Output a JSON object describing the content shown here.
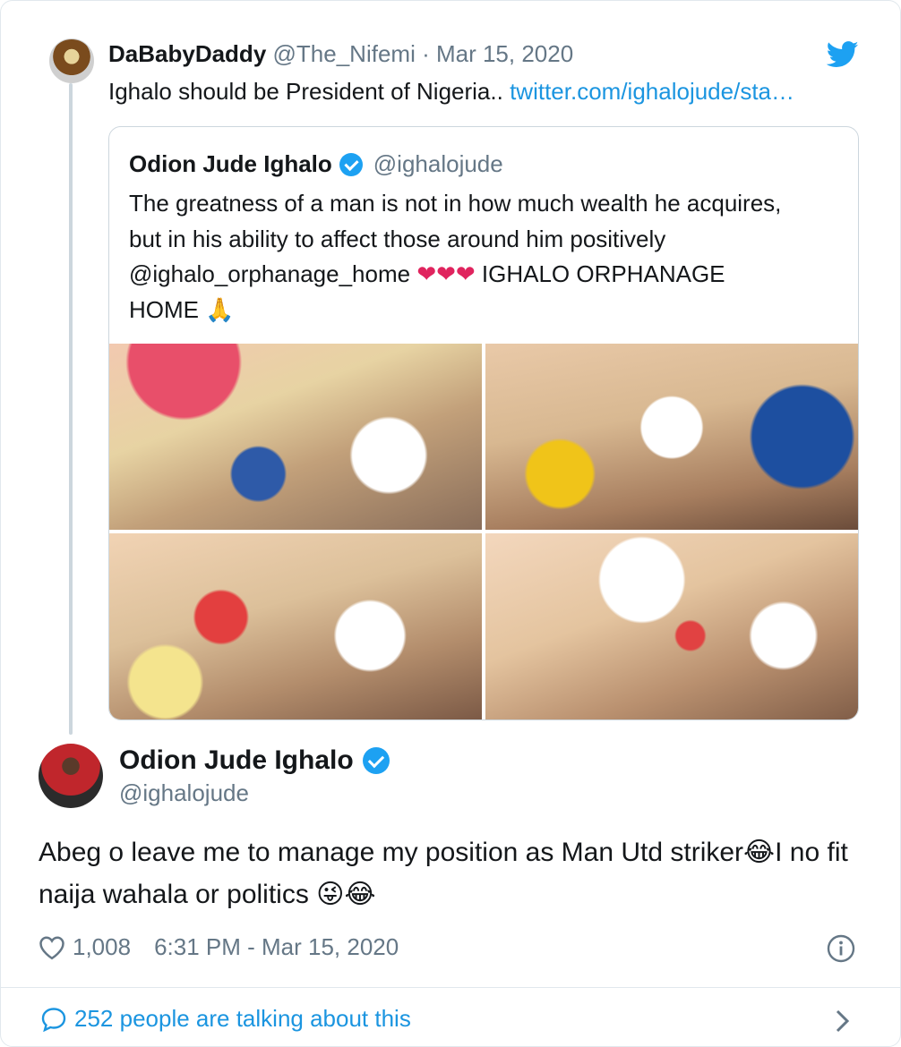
{
  "parent_tweet": {
    "name": "DaBabyDaddy",
    "handle": "@The_Nifemi",
    "separator": " · ",
    "date": "Mar 15, 2020",
    "text": "Ighalo should be President of Nigeria..",
    "link": "twitter.com/ighalojude/sta…"
  },
  "quoted_tweet": {
    "name": "Odion Jude Ighalo",
    "handle": "@ighalojude",
    "text_line1": "The greatness of a man is not in how much wealth he acquires,",
    "text_line2": "but in his ability to affect those around him positively",
    "text_mention": "@ighalo_orphanage_home ",
    "hearts": "❤❤❤",
    "text_after_hearts": " IGHALO ORPHANAGE",
    "text_line4": "HOME ",
    "pray": "🙏",
    "photos": [
      "photo-1",
      "photo-2",
      "photo-3",
      "photo-4"
    ]
  },
  "main_tweet": {
    "name": "Odion Jude Ighalo",
    "handle": "@ighalojude",
    "text_part1": "Abeg o leave me to manage my position as Man Utd striker",
    "emoji1": "😂",
    "text_part2": "I no fit naija wahala or politics ",
    "emoji2": "😜",
    "emoji3": "😂",
    "likes": "1,008",
    "timestamp": "6:31 PM - Mar 15, 2020"
  },
  "footer": {
    "talking": "252 people are talking about this"
  },
  "colors": {
    "link": "#1b95e0",
    "muted": "#657786",
    "verified": "#1da1f2"
  }
}
